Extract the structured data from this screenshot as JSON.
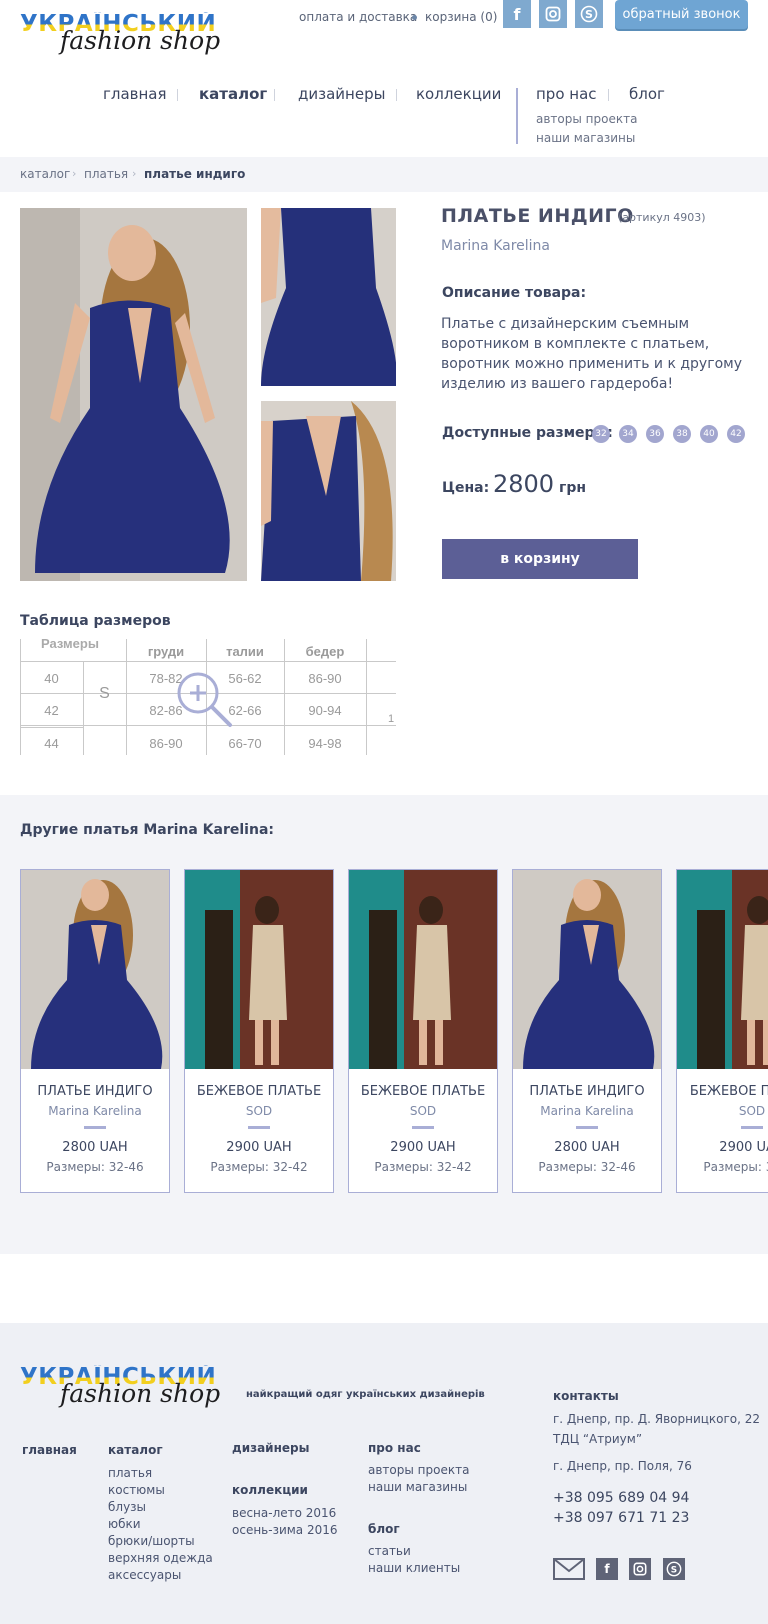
{
  "logo": {
    "line1": "УКРАЇНСЬКИЙ",
    "line2": "fashion shop"
  },
  "header": {
    "pay_delivery": "оплата и доставка",
    "cart": "корзина (0)",
    "callback": "обратный звонок",
    "social": [
      "facebook-icon",
      "instagram-icon",
      "skype-icon"
    ]
  },
  "nav": {
    "items": [
      "главная",
      "каталог",
      "дизайнеры",
      "коллекции",
      "про нас",
      "блог"
    ],
    "sub": [
      "авторы проекта",
      "наши магазины"
    ]
  },
  "breadcrumb": [
    "каталог",
    "платья",
    "платье индиго"
  ],
  "product": {
    "title": "ПЛАТЬЕ ИНДИГО",
    "article": "(артикул 4903)",
    "brand": "Marina Karelina",
    "desc_heading": "Описание товара:",
    "description": "Платье с  дизайнерским съемным воротником в комплекте с платьем, воротник можно применить и к другому изделию из вашего гардероба!",
    "sizes_label": "Доступные размеры:",
    "sizes": [
      "32",
      "34",
      "36",
      "38",
      "40",
      "42"
    ],
    "price_label": "Цена:",
    "price": "2800",
    "currency": "грн",
    "cart_button": "в корзину"
  },
  "size_table": {
    "title": "Таблица размеров",
    "head_label": "Размеры",
    "columns": [
      "груди",
      "талии",
      "бедер"
    ],
    "rows": [
      {
        "ukr": "40",
        "int": "S",
        "v": [
          "78-82",
          "56-62",
          "86-90"
        ]
      },
      {
        "ukr": "42",
        "int": "",
        "v": [
          "82-86",
          "62-66",
          "90-94"
        ]
      },
      {
        "ukr": "44",
        "int": "",
        "v": [
          "86-90",
          "66-70",
          "94-98"
        ]
      }
    ],
    "side": "1"
  },
  "others": {
    "title": "Другие платья Marina Karelina:",
    "cards": [
      {
        "name": "ПЛАТЬЕ ИНДИГО",
        "brand": "Marina Karelina",
        "price": "2800 UAH",
        "sizes": "Размеры: 32-46"
      },
      {
        "name": "БЕЖЕВОЕ ПЛАТЬЕ",
        "brand": "SOD",
        "price": "2900 UAH",
        "sizes": "Размеры: 32-42"
      },
      {
        "name": "БЕЖЕВОЕ ПЛАТЬЕ",
        "brand": "SOD",
        "price": "2900 UAH",
        "sizes": "Размеры: 32-42"
      },
      {
        "name": "ПЛАТЬЕ ИНДИГО",
        "brand": "Marina Karelina",
        "price": "2800 UAH",
        "sizes": "Размеры: 32-46"
      },
      {
        "name": "БЕЖЕВОЕ ПЛАТЬЕ",
        "brand": "SOD",
        "price": "2900 UAH",
        "sizes": "Размеры: 32-42"
      }
    ]
  },
  "footer": {
    "tagline": "найкращий одяг українських дизайнерів",
    "col1": "главная",
    "catalog_title": "каталог",
    "catalog": [
      "платья",
      "костюмы",
      "блузы",
      "юбки",
      "брюки/шорты",
      "верхняя одежда",
      "аксессуары"
    ],
    "designers": "дизайнеры",
    "collections_title": "коллекции",
    "collections": [
      "весна-лето 2016",
      "осень-зима 2016"
    ],
    "about_title": "про нас",
    "about": [
      "авторы проекта",
      "наши магазины"
    ],
    "blog_title": "блог",
    "blog": [
      "статьи",
      "наши клиенты"
    ],
    "contacts_title": "контакты",
    "address1": "г. Днепр, пр. Д. Яворницкого, 22",
    "address1b": "ТДЦ “Атриум”",
    "address2": "г. Днепр, пр. Поля, 76",
    "phone1": "+38 095 689 04 94",
    "phone2": "+38 097 671 71 23",
    "icons": [
      "mail-icon",
      "facebook-icon",
      "instagram-icon",
      "skype-icon"
    ]
  },
  "colors": {
    "accent": "#5c5f96",
    "size_badge": "#a2a6cf",
    "callback": "#6fa5d3",
    "dress": "#25307a"
  }
}
